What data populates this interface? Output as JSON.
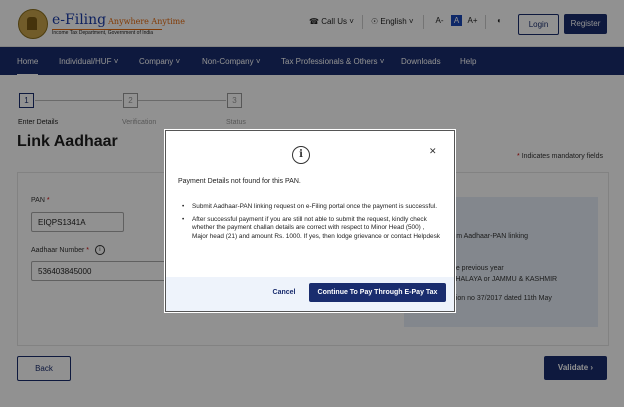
{
  "header": {
    "logo_title": "e-Filing",
    "logo_hindi": "Anywhere Anytime",
    "logo_subtitle": "Income Tax Department, Government of India",
    "call_us": "Call Us",
    "language": "English",
    "font_decrease": "A-",
    "font_normal": "A",
    "font_increase": "A+",
    "login_label": "Login",
    "register_label": "Register"
  },
  "nav": {
    "items": [
      "Home",
      "Individual/HUF",
      "Company",
      "Non-Company",
      "Tax Professionals & Others",
      "Downloads",
      "Help"
    ]
  },
  "stepper": {
    "steps": [
      {
        "num": "1",
        "label": "Enter Details"
      },
      {
        "num": "2",
        "label": "Verification"
      },
      {
        "num": "3",
        "label": "Status"
      }
    ]
  },
  "page": {
    "title": "Link Aadhaar",
    "mandatory_note": "Indicates mandatory fields"
  },
  "form": {
    "pan_label": "PAN",
    "pan_value": "EIQPS1341A",
    "aadhaar_label": "Aadhaar Number",
    "aadhaar_value": "536403845000"
  },
  "side_panel": {
    "line1": "rom Aadhaar-PAN linking",
    "line2": "the previous year",
    "line3": "GHALAYA or JAMMU & KASHMIR",
    "line4": "ation no 37/2017 dated 11th May"
  },
  "actions": {
    "back_label": "Back",
    "validate_label": "Validate"
  },
  "modal": {
    "message": "Payment Details not found for this PAN.",
    "bullets": [
      "Submit Aadhaar-PAN linking request on e-Filing portal once the payment is successful.",
      "After successful payment if you are still not able to submit the request, kindly check whether the payment challan details are correct with respect to Minor Head (500) , Major head (21) and amount Rs. 1000. If yes, then lodge grievance or contact Helpdesk"
    ],
    "cancel_label": "Cancel",
    "pay_label": "Continue To Pay Through E-Pay Tax"
  }
}
